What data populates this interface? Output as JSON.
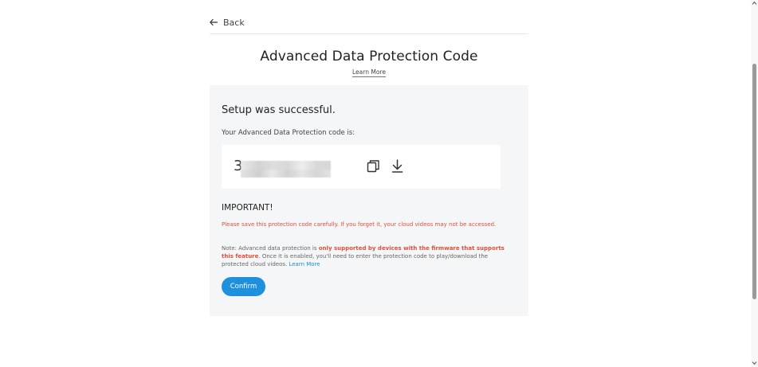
{
  "nav": {
    "back_label": "Back"
  },
  "header": {
    "title": "Advanced Data Protection Code",
    "learn_more": "Learn More"
  },
  "panel": {
    "success_message": "Setup was successful.",
    "code_label": "Your Advanced Data Protection code is:",
    "code_visible_prefix": "3",
    "copy_icon": "copy-icon",
    "download_icon": "download-icon",
    "important_heading": "IMPORTANT!",
    "warning_text": "Please save this protection code carefully. If you forget it, your cloud videos may not be accessed.",
    "note": {
      "prefix": "Note: Advanced data protection is ",
      "emphasis": "only supported by devices with the firmware that supports this feature",
      "middle": ". Once it is enabled, you'll need to enter the protection code to play/download the protected cloud videos. ",
      "link": "Learn More"
    },
    "confirm_label": "Confirm"
  },
  "colors": {
    "accent": "#1e90dd",
    "warning": "#e0503d",
    "panel_bg": "#f5f6f7"
  }
}
